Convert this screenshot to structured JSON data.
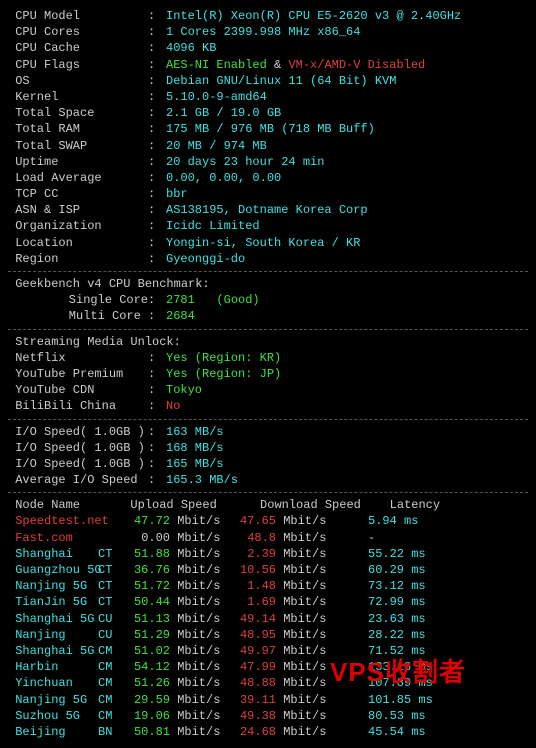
{
  "info": [
    {
      "label": "CPU Model",
      "value": "Intel(R) Xeon(R) CPU E5-2620 v3 @ 2.40GHz",
      "cls": "cyan"
    },
    {
      "label": "CPU Cores",
      "value": "1 Cores 2399.998 MHz x86_64",
      "cls": "cyan"
    },
    {
      "label": "CPU Cache",
      "value": "4096 KB",
      "cls": "cyan"
    },
    {
      "label": "CPU Flags",
      "parts": [
        {
          "t": "AES-NI Enabled",
          "cls": "green"
        },
        {
          "t": " & ",
          "cls": "dim"
        },
        {
          "t": "VM-x/AMD-V Disabled",
          "cls": "red"
        }
      ]
    },
    {
      "label": "OS",
      "value": "Debian GNU/Linux 11 (64 Bit) KVM",
      "cls": "cyan"
    },
    {
      "label": "Kernel",
      "value": "5.10.0-9-amd64",
      "cls": "cyan"
    },
    {
      "label": "Total Space",
      "value": "2.1 GB / 19.0 GB",
      "cls": "cyan"
    },
    {
      "label": "Total RAM",
      "parts": [
        {
          "t": "175 MB / 976 MB ",
          "cls": "cyan"
        },
        {
          "t": "(718 MB Buff)",
          "cls": "cyan"
        }
      ]
    },
    {
      "label": "Total SWAP",
      "value": "20 MB / 974 MB",
      "cls": "cyan"
    },
    {
      "label": "Uptime",
      "value": "20 days 23 hour 24 min",
      "cls": "cyan"
    },
    {
      "label": "Load Average",
      "value": "0.00, 0.00, 0.00",
      "cls": "cyan"
    },
    {
      "label": "TCP CC",
      "value": "bbr",
      "cls": "cyan"
    },
    {
      "label": "ASN & ISP",
      "value": "AS138195, Dotname Korea Corp",
      "cls": "cyan"
    },
    {
      "label": "Organization",
      "value": "Icidc Limited",
      "cls": "cyan"
    },
    {
      "label": "Location",
      "value": "Yongin-si, South Korea / KR",
      "cls": "cyan"
    },
    {
      "label": "Region",
      "value": "Gyeonggi-do",
      "cls": "cyan"
    }
  ],
  "geekbench": {
    "title": "Geekbench v4 CPU Benchmark:",
    "rows": [
      {
        "label": "Single Core",
        "value": "2781",
        "note": "(Good)",
        "cls": "green"
      },
      {
        "label": "Multi Core",
        "value": "2684",
        "cls": "green"
      }
    ]
  },
  "streaming": {
    "title": "Streaming Media Unlock:",
    "rows": [
      {
        "label": "Netflix",
        "value": "Yes (Region: KR)",
        "cls": "green"
      },
      {
        "label": "YouTube Premium",
        "value": "Yes (Region: JP)",
        "cls": "green"
      },
      {
        "label": "YouTube CDN",
        "value": "Tokyo",
        "cls": "green"
      },
      {
        "label": "BiliBili China",
        "value": "No",
        "cls": "red"
      }
    ]
  },
  "io": {
    "rows": [
      {
        "label": "I/O Speed( 1.0GB )",
        "value": "163 MB/s",
        "cls": "cyan"
      },
      {
        "label": "I/O Speed( 1.0GB )",
        "value": "168 MB/s",
        "cls": "cyan"
      },
      {
        "label": "I/O Speed( 1.0GB )",
        "value": "165 MB/s",
        "cls": "cyan"
      },
      {
        "label": "Average I/O Speed",
        "value": "165.3 MB/s",
        "cls": "cyan"
      }
    ]
  },
  "speedtest": {
    "headers": [
      "Node Name",
      "Upload Speed",
      "Download Speed",
      "Latency"
    ],
    "rows": [
      {
        "node": "Speedtest.net",
        "prov": "",
        "up": "47.72",
        "dn": "47.65",
        "lat": "5.94 ms",
        "nodeCls": "red",
        "upCls": "green",
        "dnCls": "red",
        "latCls": "cyan"
      },
      {
        "node": "Fast.com",
        "prov": "",
        "up": "0.00",
        "dn": "48.8",
        "lat": "-",
        "nodeCls": "red",
        "upCls": "dim",
        "dnCls": "red",
        "latCls": "dim"
      },
      {
        "node": "Shanghai",
        "prov": "CT",
        "up": "51.88",
        "dn": "2.39",
        "lat": "55.22 ms",
        "nodeCls": "cyan",
        "upCls": "green",
        "dnCls": "red",
        "latCls": "cyan"
      },
      {
        "node": "Guangzhou 5G",
        "prov": "CT",
        "up": "36.76",
        "dn": "10.56",
        "lat": "60.29 ms",
        "nodeCls": "cyan",
        "upCls": "green",
        "dnCls": "red",
        "latCls": "cyan"
      },
      {
        "node": "Nanjing 5G",
        "prov": "CT",
        "up": "51.72",
        "dn": "1.48",
        "lat": "73.12 ms",
        "nodeCls": "cyan",
        "upCls": "green",
        "dnCls": "red",
        "latCls": "cyan"
      },
      {
        "node": "TianJin 5G",
        "prov": "CT",
        "up": "50.44",
        "dn": "1.69",
        "lat": "72.99 ms",
        "nodeCls": "cyan",
        "upCls": "green",
        "dnCls": "red",
        "latCls": "cyan"
      },
      {
        "node": "Shanghai 5G",
        "prov": "CU",
        "up": "51.13",
        "dn": "49.14",
        "lat": "23.63 ms",
        "nodeCls": "cyan",
        "upCls": "green",
        "dnCls": "red",
        "latCls": "cyan"
      },
      {
        "node": "Nanjing",
        "prov": "CU",
        "up": "51.29",
        "dn": "48.95",
        "lat": "28.22 ms",
        "nodeCls": "cyan",
        "upCls": "green",
        "dnCls": "red",
        "latCls": "cyan"
      },
      {
        "node": "Shanghai 5G",
        "prov": "CM",
        "up": "51.02",
        "dn": "49.97",
        "lat": "71.52 ms",
        "nodeCls": "cyan",
        "upCls": "green",
        "dnCls": "red",
        "latCls": "cyan"
      },
      {
        "node": "Harbin",
        "prov": "CM",
        "up": "54.12",
        "dn": "47.99",
        "lat": "133.18 ms",
        "nodeCls": "cyan",
        "upCls": "green",
        "dnCls": "red",
        "latCls": "cyan"
      },
      {
        "node": "Yinchuan",
        "prov": "CM",
        "up": "51.26",
        "dn": "48.88",
        "lat": "107.89 ms",
        "nodeCls": "cyan",
        "upCls": "green",
        "dnCls": "red",
        "latCls": "cyan"
      },
      {
        "node": "Nanjing 5G",
        "prov": "CM",
        "up": "29.59",
        "dn": "39.11",
        "lat": "101.85 ms",
        "nodeCls": "cyan",
        "upCls": "green",
        "dnCls": "red",
        "latCls": "cyan"
      },
      {
        "node": "Suzhou 5G",
        "prov": "CM",
        "up": "19.06",
        "dn": "49.38",
        "lat": "80.53 ms",
        "nodeCls": "cyan",
        "upCls": "green",
        "dnCls": "red",
        "latCls": "cyan"
      },
      {
        "node": "Beijing",
        "prov": "BN",
        "up": "50.81",
        "dn": "24.68",
        "lat": "45.54 ms",
        "nodeCls": "cyan",
        "upCls": "green",
        "dnCls": "red",
        "latCls": "cyan"
      }
    ]
  },
  "watermark": "VPS收割者"
}
